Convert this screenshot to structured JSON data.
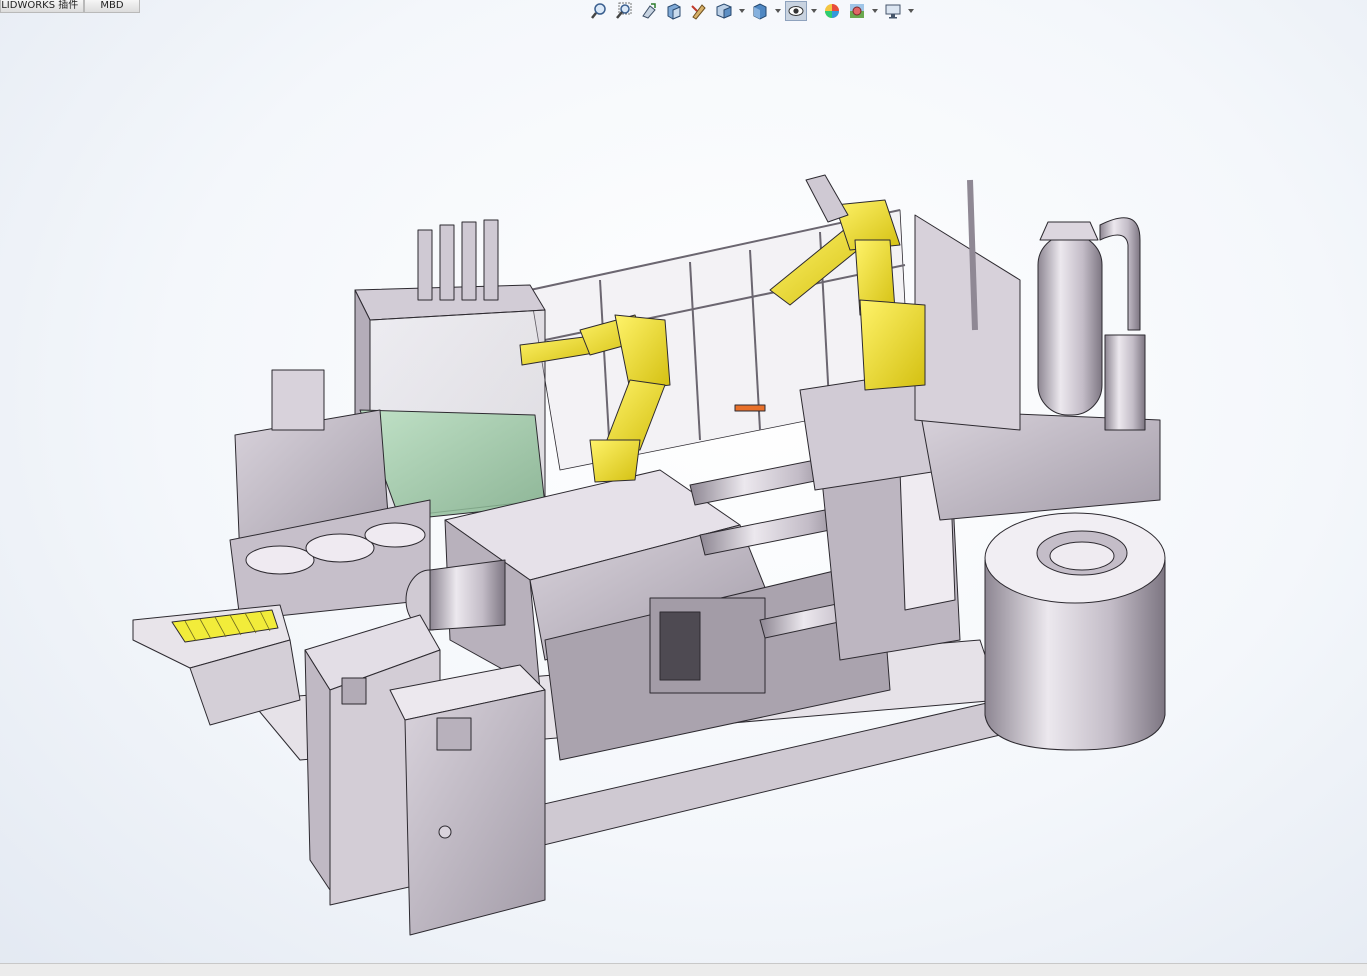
{
  "tabs": [
    {
      "label": "SOLIDWORKS 插件"
    },
    {
      "label": "MBD"
    }
  ],
  "toolbar": [
    {
      "icon": "zoom-to-fit-icon",
      "dropdown": false
    },
    {
      "icon": "zoom-to-area-icon",
      "dropdown": false
    },
    {
      "icon": "previous-view-icon",
      "dropdown": false
    },
    {
      "icon": "section-view-icon",
      "dropdown": false
    },
    {
      "icon": "dynamic-annotation-icon",
      "dropdown": false
    },
    {
      "icon": "view-orientation-icon",
      "dropdown": true
    },
    {
      "icon": "display-style-icon",
      "dropdown": true
    },
    {
      "icon": "hide-show-items-icon",
      "dropdown": true
    },
    {
      "icon": "edit-appearance-icon",
      "dropdown": false
    },
    {
      "icon": "apply-scene-icon",
      "dropdown": true
    },
    {
      "icon": "view-settings-icon",
      "dropdown": true
    }
  ],
  "colors": {
    "machine_body": "#a7a0ab",
    "machine_light": "#d6d0d9",
    "machine_dark": "#6e6873",
    "robot_yellow": "#f0e021",
    "guard_green": "#9ac9a3",
    "conveyor_yellow": "#f2ec3a",
    "accent_orange": "#e8702a"
  }
}
